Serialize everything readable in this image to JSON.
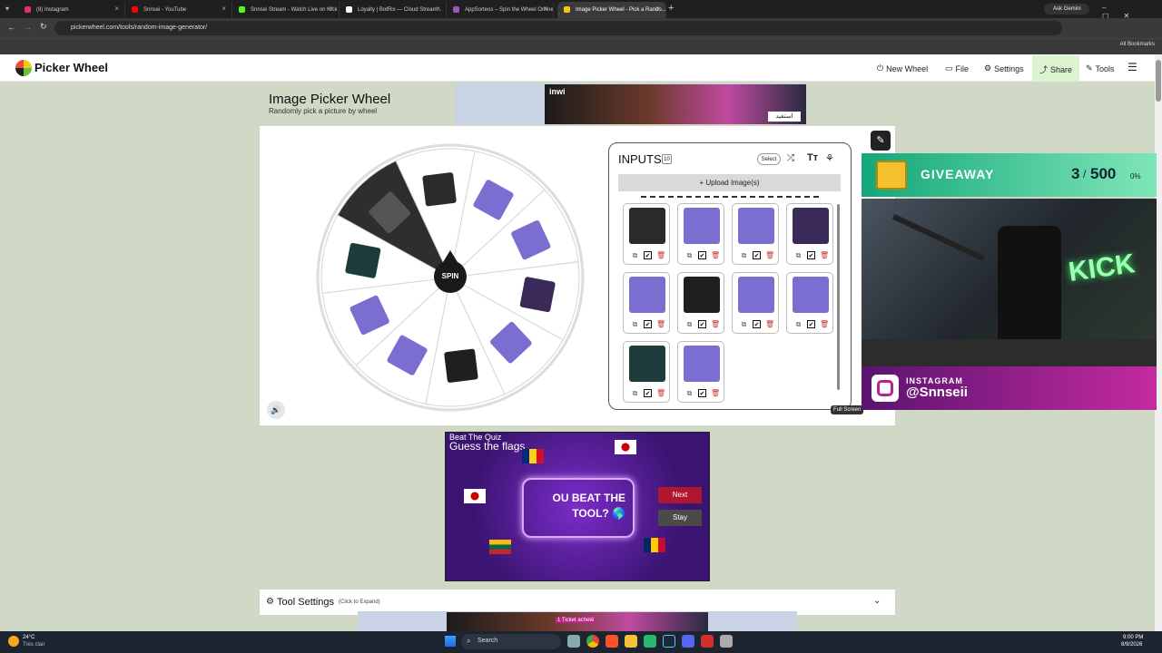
{
  "browser": {
    "tabs": [
      {
        "title": "(8) Instagram",
        "color": "#e1306c"
      },
      {
        "title": "Snnsei - YouTube",
        "color": "#ff0000"
      },
      {
        "title": "Snnsei Stream - Watch Live on Kick",
        "color": "#53fc18"
      },
      {
        "title": "Loyalty | BotRix — Cloud Stream...",
        "color": "#ffffff"
      },
      {
        "title": "AppSorteos – Spin the Wheel Online",
        "color": "#9b59b6"
      },
      {
        "title": "Image Picker Wheel - Pick a Rando...",
        "color": "#f5c518"
      }
    ],
    "url": "pickerwheel.com/tools/random-image-generator/",
    "ask_gemini": "Ask Gemini",
    "all_bookmarks": "All Bookmarks"
  },
  "site": {
    "logo": "Picker Wheel",
    "nav": [
      "New Wheel",
      "File",
      "Settings",
      "Share",
      "Tools"
    ],
    "page_title": "Image Picker Wheel",
    "page_subtitle": "Randomly pick a picture by wheel",
    "spin_label": "SPIN",
    "full_screen": "Full Screen",
    "inputs": {
      "title": "INPUTS",
      "count": "10",
      "select_label": "Select",
      "upload_label": "+ Upload Image(s)",
      "items": [
        {
          "kind": "mouse",
          "color": "#2a2a2a"
        },
        {
          "kind": "bundle",
          "color": "#7a6fd0"
        },
        {
          "kind": "bundle",
          "color": "#7a6fd0"
        },
        {
          "kind": "pc",
          "color": "#3a2a5a"
        },
        {
          "kind": "bundle",
          "color": "#7a6fd0"
        },
        {
          "kind": "box",
          "color": "#1f1f1f"
        },
        {
          "kind": "bundle",
          "color": "#7a6fd0"
        },
        {
          "kind": "bundle",
          "color": "#7a6fd0"
        },
        {
          "kind": "pc",
          "color": "#1e3b3b"
        },
        {
          "kind": "bundle",
          "color": "#7a6fd0"
        }
      ]
    },
    "quiz": {
      "header": "Beat The Quiz",
      "title": "Guess the flags",
      "main": "OU BEAT THE TOOL? 🌎",
      "next": "Next",
      "stay": "Stay"
    },
    "tool_settings": "Tool Settings",
    "tool_settings_hint": "(Click to Expand)",
    "ad_brand": "inwi",
    "ad_cta": "استفيد",
    "ad_ticket": "1 Ticket acheté"
  },
  "overlay": {
    "giveaway_label": "GIVEAWAY",
    "giveaway_count": "3",
    "giveaway_total": "500",
    "giveaway_pct": "0%",
    "insta_label": "INSTAGRAM",
    "insta_handle": "@Snnseii",
    "neon": "KICK"
  },
  "taskbar": {
    "weather_temp": "24°C",
    "weather_desc": "Très clair",
    "search": "Search",
    "time": "9:00 PM",
    "date": "8/9/2026"
  }
}
